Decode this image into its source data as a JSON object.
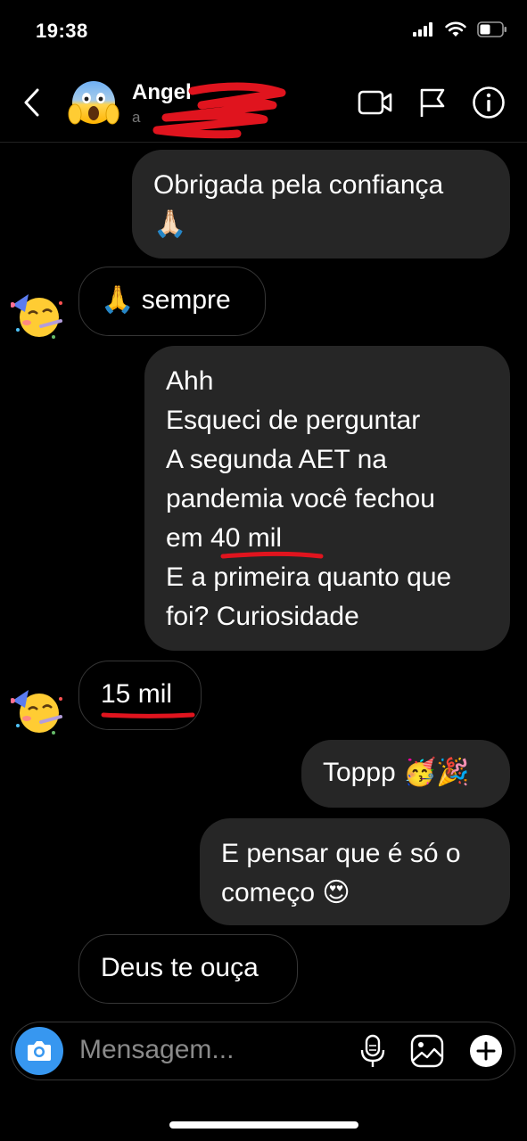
{
  "status_bar": {
    "time": "19:38"
  },
  "header": {
    "contact_name": "Angel",
    "contact_sub": "a",
    "icons": [
      "back-chevron-icon",
      "video-call-icon",
      "flag-icon",
      "info-icon"
    ],
    "avatar_emoji": "😱"
  },
  "messages": [
    {
      "side": "out",
      "lines": [
        "Obrigada pela confiança",
        "🙏🏻"
      ]
    },
    {
      "side": "in",
      "text": "🙏 sempre",
      "avatar_emoji": "🥳"
    },
    {
      "side": "out",
      "lines": [
        "Ahh",
        "Esqueci de perguntar",
        "A segunda AET na",
        "pandemia você fechou",
        "em 40 mil",
        "E a primeira quanto que",
        "foi? Curiosidade"
      ]
    },
    {
      "side": "in",
      "text": "15 mil",
      "avatar_emoji": "🥳"
    },
    {
      "side": "out",
      "text": "Toppp 🥳🎉"
    },
    {
      "side": "out",
      "lines": [
        "E pensar que é só o",
        "começo 😍"
      ]
    },
    {
      "side": "in",
      "text": "Deus te ouça"
    }
  ],
  "composer": {
    "placeholder": "Mensagem...",
    "icons": [
      "camera-icon",
      "microphone-icon",
      "gallery-icon",
      "plus-icon"
    ]
  },
  "colors": {
    "accent": "#3797f0",
    "annotation": "#e0141e",
    "bubble_out": "#262626"
  }
}
